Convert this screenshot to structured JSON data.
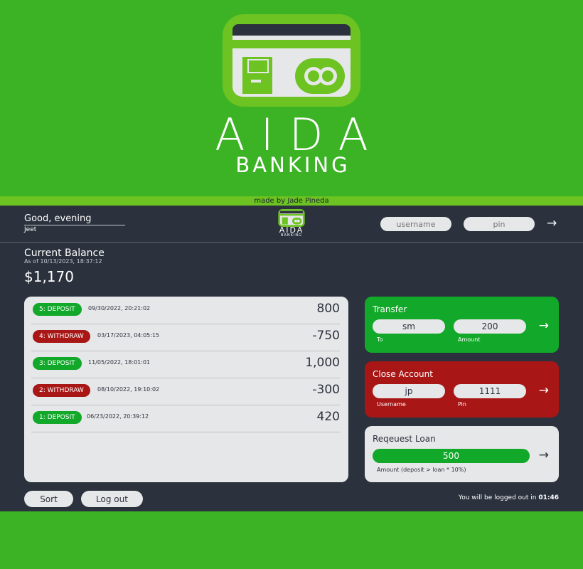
{
  "brand": {
    "title": "AIDA",
    "subtitle": "BANKING"
  },
  "credit": "made by Jade Pineda",
  "colors": {
    "page_bg": "#3cb325",
    "panel_bg": "#2b313d",
    "deposit": "#12a829",
    "withdraw": "#a81616",
    "light": "#e6e7e8"
  },
  "header": {
    "greeting": "Good, evening",
    "user": "Jeet",
    "logo_title": "AIDA",
    "logo_sub": "BANKING",
    "username_placeholder": "username",
    "pin_placeholder": "pin",
    "login_icon": "arrow-right-icon"
  },
  "balance": {
    "label": "Current Balance",
    "as_of": "As of 10/13/2023, 18:37:12",
    "value": "$1,170"
  },
  "movements": [
    {
      "badge": "5: DEPOSIT",
      "type": "deposit",
      "date": "09/30/2022, 20:21:02",
      "amount": "800"
    },
    {
      "badge": "4: WITHDRAW",
      "type": "withdraw",
      "date": "03/17/2023, 04:05:15",
      "amount": "-750"
    },
    {
      "badge": "3: DEPOSIT",
      "type": "deposit",
      "date": "11/05/2022, 18:01:01",
      "amount": "1,000"
    },
    {
      "badge": "2: WITHDRAW",
      "type": "withdraw",
      "date": "08/10/2022, 19:10:02",
      "amount": "-300"
    },
    {
      "badge": "1: DEPOSIT",
      "type": "deposit",
      "date": "06/23/2022, 20:39:12",
      "amount": "420"
    }
  ],
  "transfer": {
    "title": "Transfer",
    "to_value": "sm",
    "amount_value": "200",
    "to_label": "To",
    "amount_label": "Amount"
  },
  "close_account": {
    "title": "Close Account",
    "username_value": "jp",
    "pin_value": "1111",
    "username_label": "Username",
    "pin_label": "Pin"
  },
  "loan": {
    "title": "Reqeuest Loan",
    "amount_value": "500",
    "label": "Amount (deposit > loan * 10%)"
  },
  "controls": {
    "sort_label": "Sort",
    "logout_label": "Log out"
  },
  "timer": {
    "prefix": "You will be logged out in ",
    "time": "01:46"
  }
}
